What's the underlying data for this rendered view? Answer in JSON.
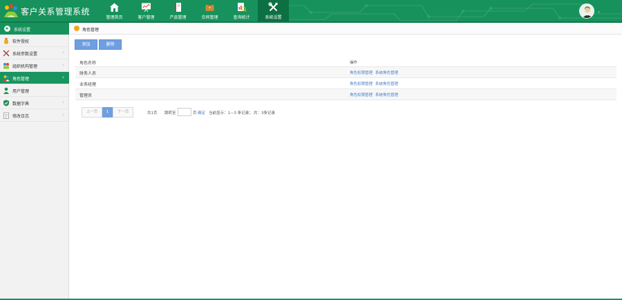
{
  "app": {
    "title": "客户关系管理系统",
    "logo_icon": "colorful-people-logo-icon"
  },
  "colors": {
    "brand": "#17925c",
    "brand_dark": "#0c7042",
    "accent_button": "#6f9fe0",
    "link": "#4a7fc8",
    "active_underline": "#f0c000"
  },
  "topnav": [
    {
      "label": "管理首页",
      "icon": "home-icon",
      "active": false
    },
    {
      "label": "客户管理",
      "icon": "chart-board-icon",
      "active": false
    },
    {
      "label": "产品管理",
      "icon": "book-icon",
      "active": false
    },
    {
      "label": "合同管理",
      "icon": "briefcase-icon",
      "active": false
    },
    {
      "label": "查询统计",
      "icon": "report-magnifier-icon",
      "active": false
    },
    {
      "label": "系统设置",
      "icon": "tools-icon",
      "active": true
    }
  ],
  "user": {
    "avatar_icon": "user-avatar-icon",
    "caret": "⌄"
  },
  "sidebar": {
    "header": "系统设置",
    "items": [
      {
        "label": "软件授权",
        "icon": "money-bag-icon",
        "active": false
      },
      {
        "label": "系统参数设置",
        "icon": "tools-icon",
        "active": false
      },
      {
        "label": "组织机构管理",
        "icon": "org-people-icon",
        "active": false
      },
      {
        "label": "角色管理",
        "icon": "role-people-icon",
        "active": true
      },
      {
        "label": "用户管理",
        "icon": "user-icon",
        "active": false
      },
      {
        "label": "数据字典",
        "icon": "shield-book-icon",
        "active": false
      },
      {
        "label": "修改日志",
        "icon": "log-book-icon",
        "active": false
      }
    ]
  },
  "breadcrumb": {
    "text": "角色管理"
  },
  "toolbar": {
    "add_label": "添加",
    "delete_label": "删除"
  },
  "table": {
    "headers": {
      "name": "角色名称",
      "ops": "操作"
    },
    "rows": [
      {
        "name": "财务人员",
        "op1": "角色权限管理",
        "op2": "系统角色管理"
      },
      {
        "name": "业务经理",
        "op1": "角色权限管理",
        "op2": "系统角色管理"
      },
      {
        "name": "管理员",
        "op1": "角色权限管理",
        "op2": "系统角色管理"
      }
    ]
  },
  "pager": {
    "prev": "上一页",
    "current": "1",
    "next": "下一页",
    "total_pages": "共1页",
    "jump_prefix": "跳转至",
    "jump_suffix": "页",
    "jump_button": "确定",
    "record_range": "当前显示：1—3 条记录；",
    "total_records": "共：3条记录"
  }
}
